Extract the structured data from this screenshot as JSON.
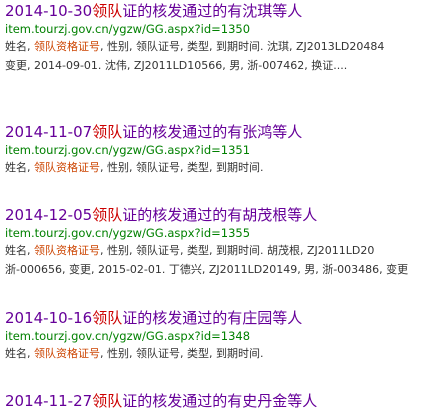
{
  "results": [
    {
      "title_pre": "2014-10-30",
      "title_hl": "领队",
      "title_post": "证的核发通过的有沈琪等人",
      "url": "item.tourzj.gov.cn/ygzw/GG.aspx?id=1350",
      "snippet_line1_pre": "姓名, ",
      "snippet_line1_hl": "领队资格证号",
      "snippet_line1_post": ", 性别, 领队证号, 类型, 到期时间. 沈琪, ZJ2013LD20484",
      "snippet_line2": "变更, 2014-09-01. 沈伟, ZJ2011LD10566, 男, 浙-007462, 换证...."
    },
    {
      "title_pre": "2014-11-07",
      "title_hl": "领队",
      "title_post": "证的核发通过的有张鸿等人",
      "url": "item.tourzj.gov.cn/ygzw/GG.aspx?id=1351",
      "snippet_line1_pre": "姓名, ",
      "snippet_line1_hl": "领队资格证号",
      "snippet_line1_post": ", 性别, 领队证号, 类型, 到期时间.",
      "snippet_line2": ""
    },
    {
      "title_pre": "2014-12-05",
      "title_hl": "领队",
      "title_post": "证的核发通过的有胡茂根等人",
      "url": "item.tourzj.gov.cn/ygzw/GG.aspx?id=1355",
      "snippet_line1_pre": "姓名, ",
      "snippet_line1_hl": "领队资格证号",
      "snippet_line1_post": ", 性别, 领队证号, 类型, 到期时间. 胡茂根, ZJ2011LD20",
      "snippet_line2": "浙-000656, 变更, 2015-02-01. 丁德兴, ZJ2011LD20149, 男, 浙-003486, 变更"
    },
    {
      "title_pre": "2014-10-16",
      "title_hl": "领队",
      "title_post": "证的核发通过的有庄园等人",
      "url": "item.tourzj.gov.cn/ygzw/GG.aspx?id=1348",
      "snippet_line1_pre": "姓名, ",
      "snippet_line1_hl": "领队资格证号",
      "snippet_line1_post": ", 性别, 领队证号, 类型, 到期时间.",
      "snippet_line2": ""
    },
    {
      "title_pre": "2014-11-27",
      "title_hl": "领队",
      "title_post": "证的核发通过的有史丹金等人",
      "url": "",
      "snippet_line1_pre": "",
      "snippet_line1_hl": "",
      "snippet_line1_post": "",
      "snippet_line2": ""
    }
  ]
}
